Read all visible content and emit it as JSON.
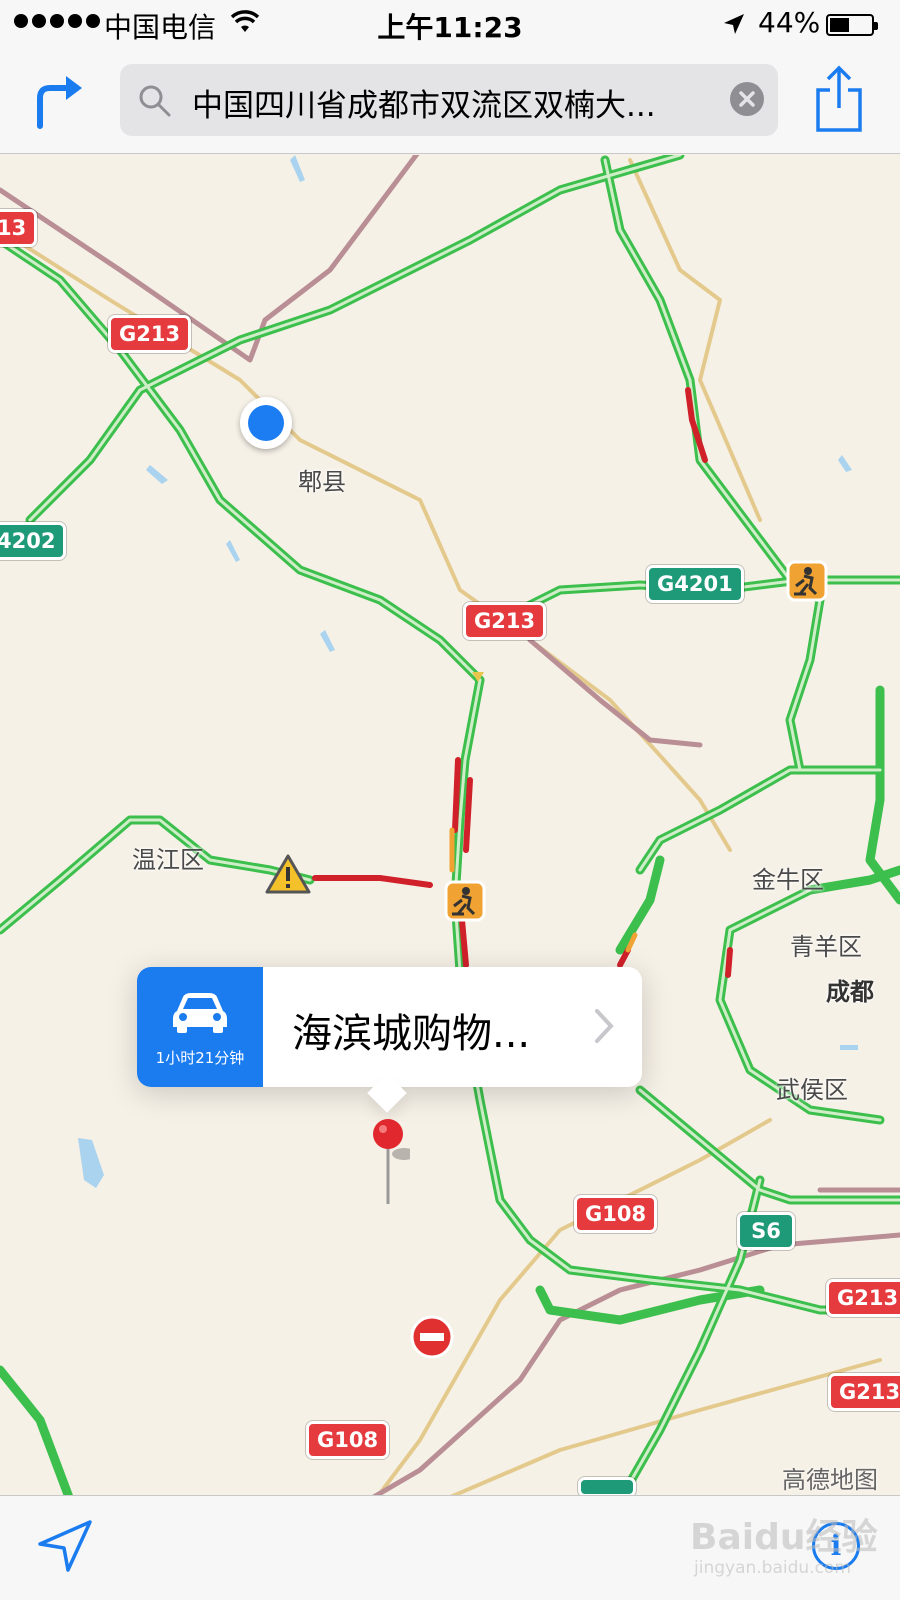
{
  "status_bar": {
    "carrier": "中国电信",
    "time": "上午11:23",
    "battery": "44%",
    "battery_level": 0.44
  },
  "nav_bar": {
    "search_text": "中国四川省成都市双流区双楠大...",
    "icons": [
      "directions-icon",
      "search-icon",
      "clear-icon",
      "share-icon"
    ]
  },
  "map": {
    "route_badges": {
      "g213_a": "13",
      "g213_b": "G213",
      "g4202": "4202",
      "g213_c": "G213",
      "g4201": "G4201",
      "g108_a": "G108",
      "s6": "S6",
      "g213_d": "G213",
      "g213_e": "G213",
      "g108_b": "G108"
    },
    "places": {
      "pixian": "郫县",
      "wenjiang": "温江区",
      "jinniu": "金牛区",
      "qingyang": "青羊区",
      "chengdu": "成都",
      "wuhou": "武侯区"
    },
    "attribution": "高德地图",
    "colors": {
      "road_green": "#3cbf4d",
      "road_red": "#d0202a",
      "road_orange": "#f0a232",
      "badge_red": "#e63b3e",
      "badge_green": "#1f9a78",
      "user_dot": "#1c7cf2"
    }
  },
  "callout": {
    "eta": "1小时21分钟",
    "title": "海滨城购物..."
  },
  "watermark": {
    "brand": "Baidu经验",
    "url": "jingyan.baidu.com"
  },
  "toolbar": {
    "info": "i"
  }
}
